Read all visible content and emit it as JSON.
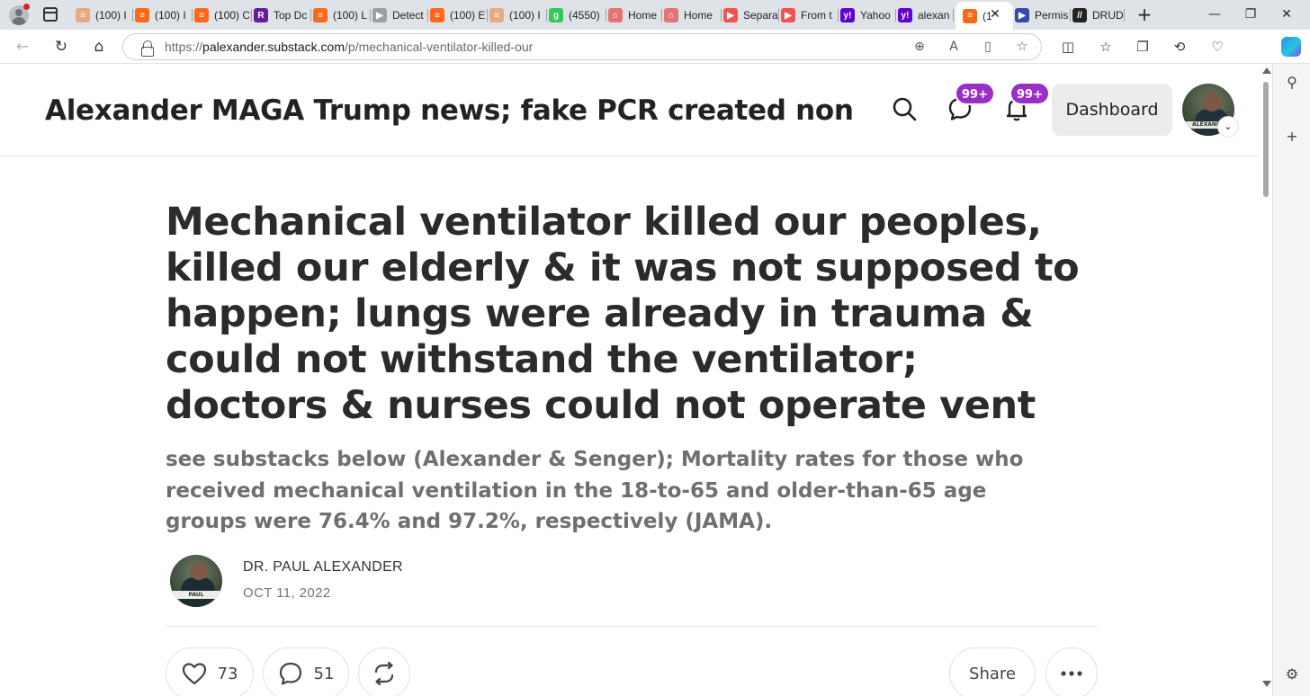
{
  "browser": {
    "tabs": [
      {
        "label": "(100) I",
        "favicon": "substack-icon",
        "color": "#e8a882"
      },
      {
        "label": "(100) I",
        "favicon": "substack-icon",
        "color": "#ff6719"
      },
      {
        "label": "(100) C",
        "favicon": "substack-icon",
        "color": "#ff6719"
      },
      {
        "label": "Top Dc",
        "favicon": "r-logo-icon",
        "color": "#6a1b9a"
      },
      {
        "label": "(100) L",
        "favicon": "substack-icon",
        "color": "#ff6719"
      },
      {
        "label": "Detect",
        "favicon": "arrow-icon",
        "color": "#9e9e9e"
      },
      {
        "label": "(100) E",
        "favicon": "substack-icon",
        "color": "#ff6719"
      },
      {
        "label": "(100) I",
        "favicon": "substack-icon",
        "color": "#e8a882"
      },
      {
        "label": "(4550)",
        "favicon": "g-logo-icon",
        "color": "#34c759"
      },
      {
        "label": "Home",
        "favicon": "home-icon",
        "color": "#e57373"
      },
      {
        "label": "Home",
        "favicon": "home-icon",
        "color": "#e57373"
      },
      {
        "label": "Separa",
        "favicon": "youtube-icon",
        "color": "#ef5350"
      },
      {
        "label": "From t",
        "favicon": "youtube-icon",
        "color": "#ef5350"
      },
      {
        "label": "Yahoo",
        "favicon": "yahoo-icon",
        "color": "#6001d2"
      },
      {
        "label": "alexan",
        "favicon": "yahoo-icon",
        "color": "#6001d2"
      },
      {
        "label": "(1",
        "favicon": "substack-icon",
        "color": "#ff6719"
      },
      {
        "label": "Permis",
        "favicon": "arrow-icon",
        "color": "#3949ab"
      },
      {
        "label": "DRUD",
        "favicon": "drudge-icon",
        "color": "#222222"
      }
    ],
    "active_tab_index": 15,
    "url_prefix": "https://",
    "url_host": "palexander.substack.com",
    "url_path": "/p/mechanical-ventilator-killed-our"
  },
  "header": {
    "site_title": "Alexander MAGA Trump news; fake PCR created non-p...",
    "chat_badge": "99+",
    "notification_badge": "99+",
    "dashboard_label": "Dashboard",
    "avatar_sign_text": "ALEXANDE"
  },
  "post": {
    "title": "Mechanical ventilator killed our peoples, killed our elderly & it was not supposed to happen; lungs were already in trauma & could not withstand the ventilator; doctors & nurses could not operate vent",
    "subtitle": "see substacks below (Alexander & Senger); Mortality rates for those who received mechanical ventilation in the 18-to-65 and older-than-65 age groups were 76.4% and 97.2%, respectively (JAMA).",
    "author": "DR. PAUL ALEXANDER",
    "date": "OCT 11, 2022",
    "author_avatar_sign": "PAUL ALEXANDER"
  },
  "actions": {
    "likes": "73",
    "comments": "51",
    "share_label": "Share"
  },
  "colors": {
    "badge": "#9a2ec5",
    "title_text": "#2b2b2b",
    "subtitle_text": "#6f6f6f"
  }
}
